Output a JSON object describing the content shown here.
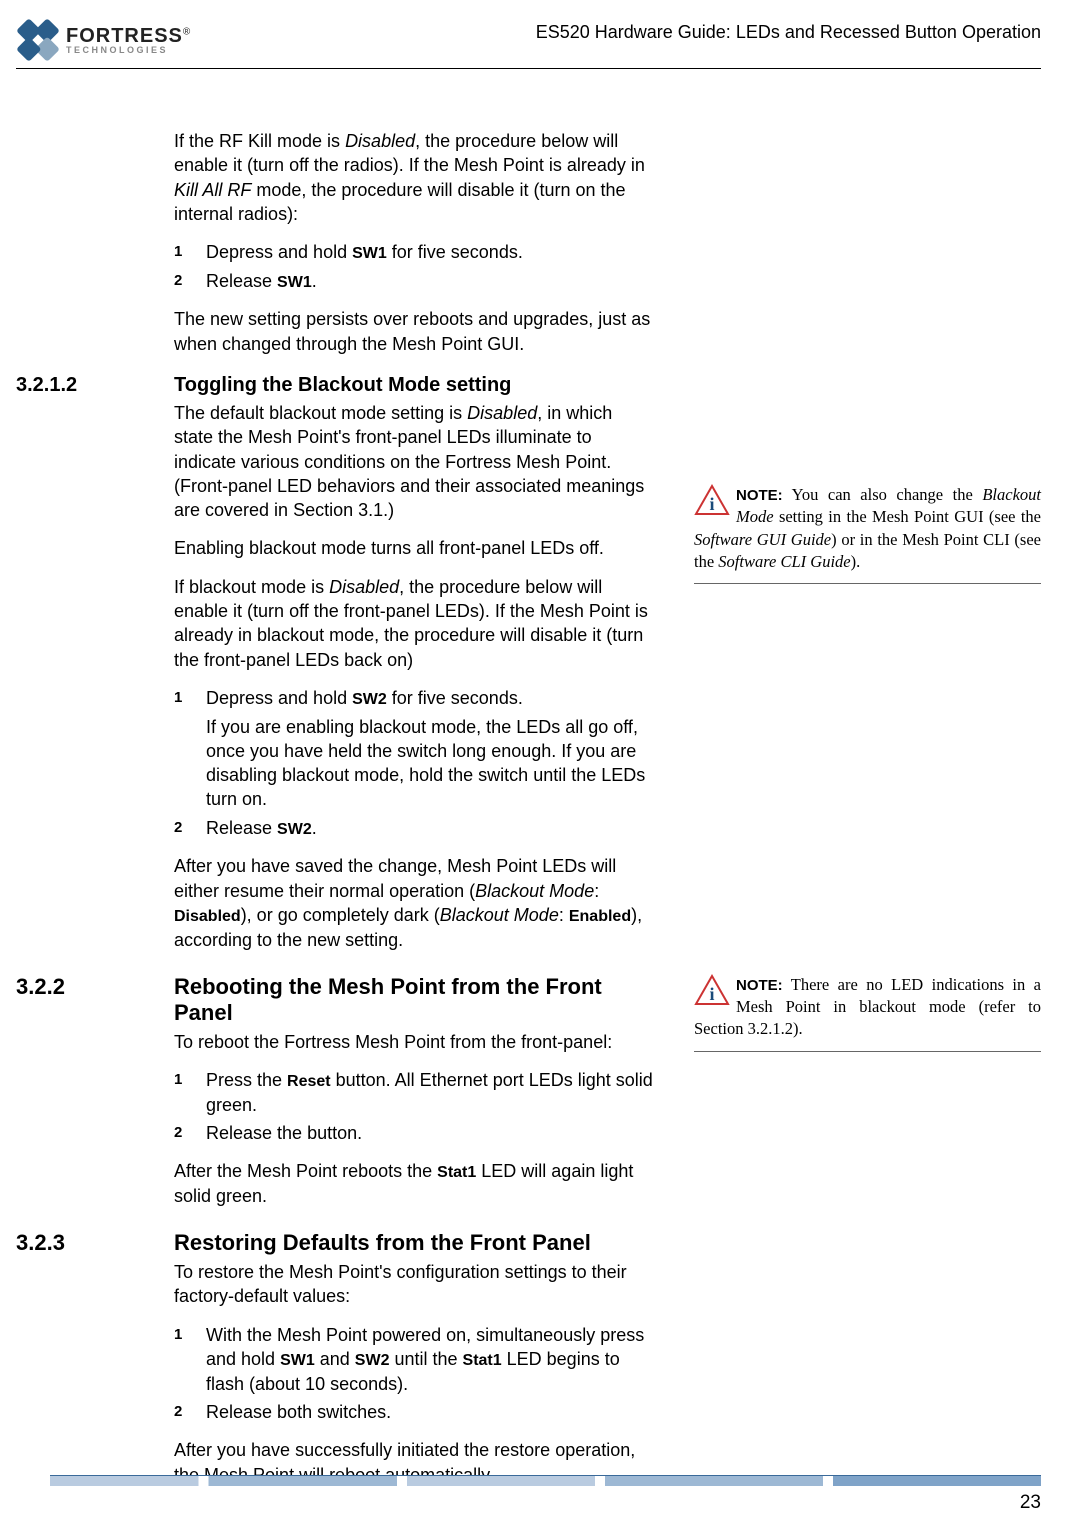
{
  "header": {
    "brand": "FORTRESS",
    "brand_sub": "TECHNOLOGIES",
    "reg": "®",
    "doc_title": "ES520 Hardware Guide: LEDs and Recessed Button Operation"
  },
  "intro": {
    "p1_a": "If the RF Kill mode is ",
    "p1_b": "Disabled",
    "p1_c": ", the procedure below will enable it (turn off the radios). If the Mesh Point is already in ",
    "p1_d": "Kill All RF",
    "p1_e": " mode, the procedure will disable it (turn on the internal radios):",
    "step1_a": "Depress and hold ",
    "step1_b": "SW1",
    "step1_c": " for five seconds.",
    "step2_a": "Release ",
    "step2_b": "SW1",
    "step2_c": ".",
    "p2": "The new setting persists over reboots and upgrades, just as when changed through the Mesh Point GUI."
  },
  "s3212": {
    "num": "3.2.1.2",
    "title": "Toggling the Blackout Mode setting",
    "p1_a": "The default blackout mode setting is ",
    "p1_b": "Disabled",
    "p1_c": ", in which state the Mesh Point's front-panel LEDs illuminate to indicate various conditions on the Fortress Mesh Point. (Front-panel LED behaviors and their associated meanings are covered in Section 3.1.)",
    "p2": "Enabling blackout mode turns all front-panel LEDs off.",
    "p3_a": "If blackout mode is ",
    "p3_b": "Disabled",
    "p3_c": ", the procedure below will enable it (turn off the front-panel LEDs). If the Mesh Point is already in blackout mode, the procedure will disable it (turn the front-panel LEDs back on)",
    "step1_a": "Depress and hold ",
    "step1_b": "SW2",
    "step1_c": " for five seconds.",
    "step1_sub": "If you are enabling blackout mode, the LEDs all go off, once you have held the switch long enough. If you are disabling blackout mode, hold the switch until the LEDs turn on.",
    "step2_a": "Release ",
    "step2_b": "SW2",
    "step2_c": ".",
    "p4_a": "After you have saved the change, Mesh Point LEDs will either resume their normal operation (",
    "p4_b": "Blackout Mode",
    "p4_c": ": ",
    "p4_d": "Disabled",
    "p4_e": "), or go completely dark (",
    "p4_f": "Blackout Mode",
    "p4_g": ": ",
    "p4_h": "Enabled",
    "p4_i": "), according to the new setting."
  },
  "s322": {
    "num": "3.2.2",
    "title": "Rebooting the Mesh Point from the Front Panel",
    "p1": "To reboot the Fortress Mesh Point from the front-panel:",
    "step1_a": "Press the ",
    "step1_b": "Reset",
    "step1_c": " button. All Ethernet port LEDs light solid green.",
    "step2": "Release the button.",
    "p2_a": "After the Mesh Point reboots the ",
    "p2_b": "Stat1",
    "p2_c": " LED will again light solid green."
  },
  "s323": {
    "num": "3.2.3",
    "title": "Restoring Defaults from the Front Panel",
    "p1": "To restore the Mesh Point's configuration settings to their factory-default values:",
    "step1_a": "With the Mesh Point powered on, simultaneously press and hold ",
    "step1_b": "SW1",
    "step1_c": " and ",
    "step1_d": "SW2",
    "step1_e": " until the ",
    "step1_f": "Stat1",
    "step1_g": " LED begins to flash (about 10 seconds).",
    "step2": "Release both switches.",
    "p2": "After you have successfully initiated the restore operation, the Mesh Point will reboot automatically."
  },
  "note1": {
    "label": "NOTE:",
    "t1": " You can also change the ",
    "t2": "Blackout Mode",
    "t3": " setting in the Mesh Point GUI (see the ",
    "t4": "Software GUI Guide",
    "t5": ") or in the Mesh Point CLI (see the ",
    "t6": "Software CLI Guide",
    "t7": ")."
  },
  "note2": {
    "label": "NOTE:",
    "t1": " There are no LED indications in a Mesh Point in blackout mode (refer to Section 3.2.1.2)."
  },
  "list_nums": {
    "n1": "1",
    "n2": "2"
  },
  "page_number": "23"
}
